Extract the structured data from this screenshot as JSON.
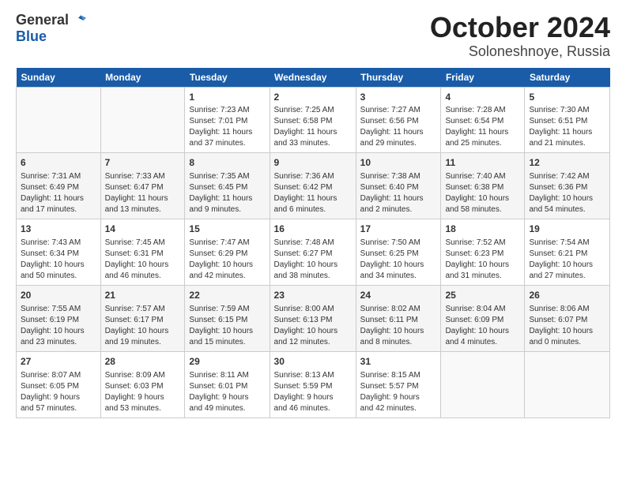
{
  "header": {
    "logo_general": "General",
    "logo_blue": "Blue",
    "month": "October 2024",
    "location": "Soloneshnoye, Russia"
  },
  "weekdays": [
    "Sunday",
    "Monday",
    "Tuesday",
    "Wednesday",
    "Thursday",
    "Friday",
    "Saturday"
  ],
  "rows": [
    [
      {
        "day": "",
        "info": ""
      },
      {
        "day": "",
        "info": ""
      },
      {
        "day": "1",
        "info": "Sunrise: 7:23 AM\nSunset: 7:01 PM\nDaylight: 11 hours\nand 37 minutes."
      },
      {
        "day": "2",
        "info": "Sunrise: 7:25 AM\nSunset: 6:58 PM\nDaylight: 11 hours\nand 33 minutes."
      },
      {
        "day": "3",
        "info": "Sunrise: 7:27 AM\nSunset: 6:56 PM\nDaylight: 11 hours\nand 29 minutes."
      },
      {
        "day": "4",
        "info": "Sunrise: 7:28 AM\nSunset: 6:54 PM\nDaylight: 11 hours\nand 25 minutes."
      },
      {
        "day": "5",
        "info": "Sunrise: 7:30 AM\nSunset: 6:51 PM\nDaylight: 11 hours\nand 21 minutes."
      }
    ],
    [
      {
        "day": "6",
        "info": "Sunrise: 7:31 AM\nSunset: 6:49 PM\nDaylight: 11 hours\nand 17 minutes."
      },
      {
        "day": "7",
        "info": "Sunrise: 7:33 AM\nSunset: 6:47 PM\nDaylight: 11 hours\nand 13 minutes."
      },
      {
        "day": "8",
        "info": "Sunrise: 7:35 AM\nSunset: 6:45 PM\nDaylight: 11 hours\nand 9 minutes."
      },
      {
        "day": "9",
        "info": "Sunrise: 7:36 AM\nSunset: 6:42 PM\nDaylight: 11 hours\nand 6 minutes."
      },
      {
        "day": "10",
        "info": "Sunrise: 7:38 AM\nSunset: 6:40 PM\nDaylight: 11 hours\nand 2 minutes."
      },
      {
        "day": "11",
        "info": "Sunrise: 7:40 AM\nSunset: 6:38 PM\nDaylight: 10 hours\nand 58 minutes."
      },
      {
        "day": "12",
        "info": "Sunrise: 7:42 AM\nSunset: 6:36 PM\nDaylight: 10 hours\nand 54 minutes."
      }
    ],
    [
      {
        "day": "13",
        "info": "Sunrise: 7:43 AM\nSunset: 6:34 PM\nDaylight: 10 hours\nand 50 minutes."
      },
      {
        "day": "14",
        "info": "Sunrise: 7:45 AM\nSunset: 6:31 PM\nDaylight: 10 hours\nand 46 minutes."
      },
      {
        "day": "15",
        "info": "Sunrise: 7:47 AM\nSunset: 6:29 PM\nDaylight: 10 hours\nand 42 minutes."
      },
      {
        "day": "16",
        "info": "Sunrise: 7:48 AM\nSunset: 6:27 PM\nDaylight: 10 hours\nand 38 minutes."
      },
      {
        "day": "17",
        "info": "Sunrise: 7:50 AM\nSunset: 6:25 PM\nDaylight: 10 hours\nand 34 minutes."
      },
      {
        "day": "18",
        "info": "Sunrise: 7:52 AM\nSunset: 6:23 PM\nDaylight: 10 hours\nand 31 minutes."
      },
      {
        "day": "19",
        "info": "Sunrise: 7:54 AM\nSunset: 6:21 PM\nDaylight: 10 hours\nand 27 minutes."
      }
    ],
    [
      {
        "day": "20",
        "info": "Sunrise: 7:55 AM\nSunset: 6:19 PM\nDaylight: 10 hours\nand 23 minutes."
      },
      {
        "day": "21",
        "info": "Sunrise: 7:57 AM\nSunset: 6:17 PM\nDaylight: 10 hours\nand 19 minutes."
      },
      {
        "day": "22",
        "info": "Sunrise: 7:59 AM\nSunset: 6:15 PM\nDaylight: 10 hours\nand 15 minutes."
      },
      {
        "day": "23",
        "info": "Sunrise: 8:00 AM\nSunset: 6:13 PM\nDaylight: 10 hours\nand 12 minutes."
      },
      {
        "day": "24",
        "info": "Sunrise: 8:02 AM\nSunset: 6:11 PM\nDaylight: 10 hours\nand 8 minutes."
      },
      {
        "day": "25",
        "info": "Sunrise: 8:04 AM\nSunset: 6:09 PM\nDaylight: 10 hours\nand 4 minutes."
      },
      {
        "day": "26",
        "info": "Sunrise: 8:06 AM\nSunset: 6:07 PM\nDaylight: 10 hours\nand 0 minutes."
      }
    ],
    [
      {
        "day": "27",
        "info": "Sunrise: 8:07 AM\nSunset: 6:05 PM\nDaylight: 9 hours\nand 57 minutes."
      },
      {
        "day": "28",
        "info": "Sunrise: 8:09 AM\nSunset: 6:03 PM\nDaylight: 9 hours\nand 53 minutes."
      },
      {
        "day": "29",
        "info": "Sunrise: 8:11 AM\nSunset: 6:01 PM\nDaylight: 9 hours\nand 49 minutes."
      },
      {
        "day": "30",
        "info": "Sunrise: 8:13 AM\nSunset: 5:59 PM\nDaylight: 9 hours\nand 46 minutes."
      },
      {
        "day": "31",
        "info": "Sunrise: 8:15 AM\nSunset: 5:57 PM\nDaylight: 9 hours\nand 42 minutes."
      },
      {
        "day": "",
        "info": ""
      },
      {
        "day": "",
        "info": ""
      }
    ]
  ]
}
